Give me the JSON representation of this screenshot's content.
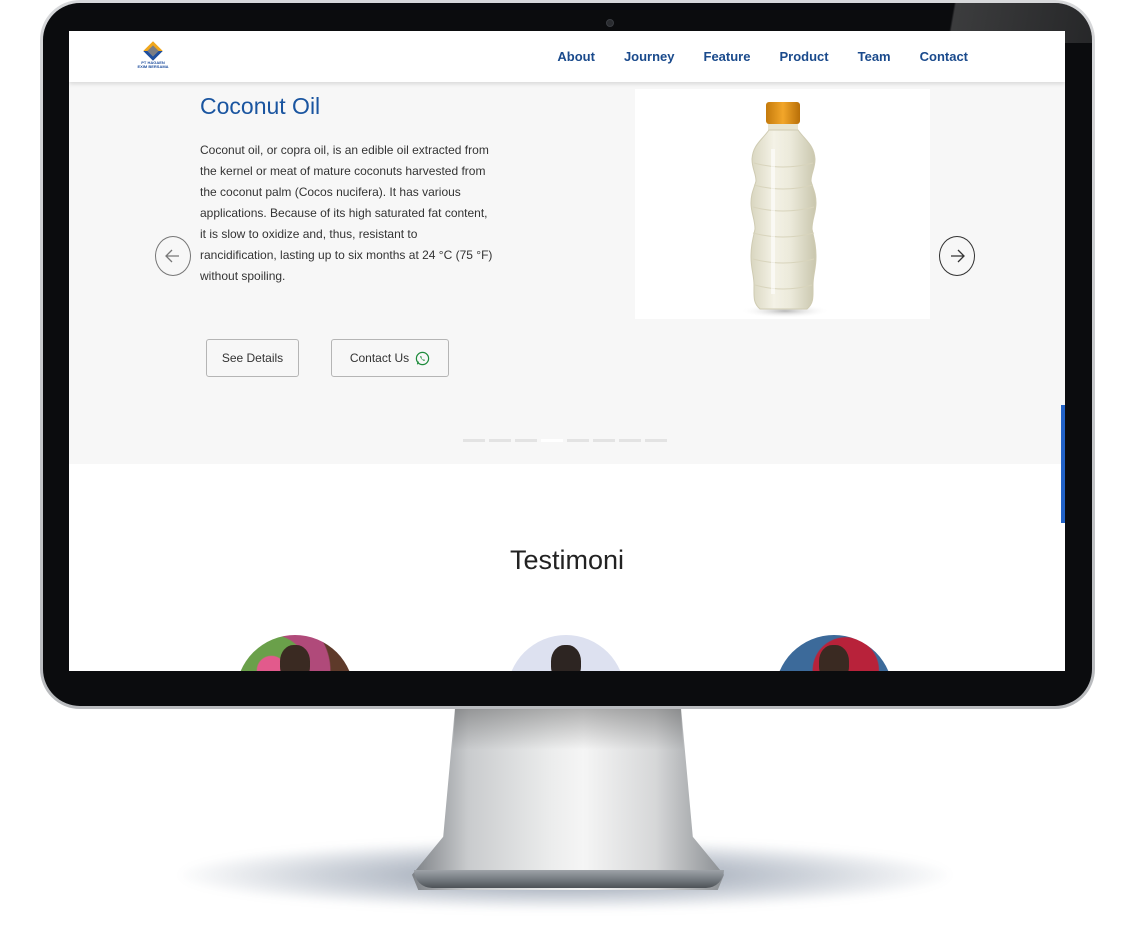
{
  "nav": {
    "logo_text": "PT HAGAEN EXIM BERSAMA",
    "links": [
      "About",
      "Journey",
      "Feature",
      "Product",
      "Team",
      "Contact"
    ]
  },
  "product": {
    "title": "Coconut Oil",
    "description": "Coconut oil, or copra oil, is an edible oil extracted from the kernel or meat of mature coconuts harvested from the coconut palm (Cocos nucifera). It has various applications. Because of its high saturated fat content, it is slow to oxidize and, thus, resistant to rancidification, lasting up to six months at 24 °C (75 °F) without spoiling.",
    "see_details_label": "See Details",
    "contact_label": "Contact Us",
    "image_alt": "coconut oil bottle"
  },
  "carousel": {
    "slide_count": 8,
    "active_index": 3
  },
  "testimoni": {
    "title": "Testimoni"
  },
  "colors": {
    "nav_link": "#1a4a8c",
    "title": "#1a55a0",
    "scrollbar": "#2262c6",
    "section_bg": "#f7f7f7",
    "whatsapp": "#1c8a3a"
  },
  "icons": {
    "prev": "arrow-left-icon",
    "next": "arrow-right-icon",
    "contact": "whatsapp-icon"
  }
}
